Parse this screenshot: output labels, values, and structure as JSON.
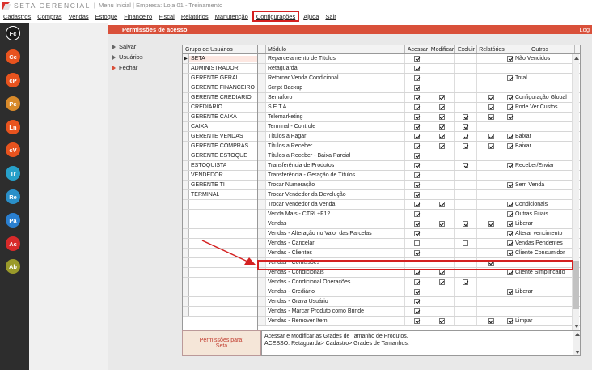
{
  "titlebar": {
    "app_name": "SETA GERENCIAL",
    "sep": "|",
    "info": "Menu Inicial | Empresa: Loja 01 - Treinamento"
  },
  "menu": [
    "Cadastros",
    "Compras",
    "Vendas",
    "Estoque",
    "Financeiro",
    "Fiscal",
    "Relatórios",
    "Manutenção",
    "Configurações",
    "Ajuda",
    "Sair"
  ],
  "sidebar": [
    {
      "label": "Fc",
      "color": "#1a1a1a"
    },
    {
      "label": "Cc",
      "color": "#e8531e"
    },
    {
      "label": "cP",
      "color": "#e8531e"
    },
    {
      "label": "Pc",
      "color": "#d88a2a"
    },
    {
      "label": "Ln",
      "color": "#e8531e"
    },
    {
      "label": "cV",
      "color": "#e8531e"
    },
    {
      "label": "Tr",
      "color": "#27a0c9"
    },
    {
      "label": "Re",
      "color": "#2a8fc9"
    },
    {
      "label": "Pa",
      "color": "#2a7fd0"
    },
    {
      "label": "Ac",
      "color": "#d82a2a"
    },
    {
      "label": "Ab",
      "color": "#9a9a2a"
    }
  ],
  "panel": {
    "title": "Permissões de acesso",
    "log": "Log"
  },
  "actions": [
    "Salvar",
    "Usuários",
    "Fechar"
  ],
  "groups_header": "Grupo de Usuários",
  "groups": [
    "SETA",
    "ADMINISTRADOR",
    "GERENTE GERAL",
    "GERENTE FINANCEIRO",
    "GERENTE CREDIARIO",
    "CREDIARIO",
    "GERENTE CAIXA",
    "CAIXA",
    "GERENTE VENDAS",
    "GERENTE COMPRAS",
    "GERENTE ESTOQUE",
    "ESTOQUISTA",
    "VENDEDOR",
    "GERENTE TI",
    "TERMINAL"
  ],
  "selected_group_index": 0,
  "columns": [
    "Módulo",
    "Acessar",
    "Modificar",
    "Excluir",
    "Relatórios",
    "Outros"
  ],
  "modules": [
    {
      "name": "Reparcelamento de Títulos",
      "ac": true,
      "mo": null,
      "ex": null,
      "re": null,
      "ou": "Não Vencidos",
      "ouc": true
    },
    {
      "name": "Retaguarda",
      "ac": true,
      "mo": null,
      "ex": null,
      "re": null,
      "ou": "",
      "ouc": null
    },
    {
      "name": "Retornar Venda Condicional",
      "ac": true,
      "mo": null,
      "ex": null,
      "re": null,
      "ou": "Total",
      "ouc": true
    },
    {
      "name": "Script Backup",
      "ac": true,
      "mo": null,
      "ex": null,
      "re": null,
      "ou": "",
      "ouc": null
    },
    {
      "name": "Semaforo",
      "ac": true,
      "mo": true,
      "ex": null,
      "re": true,
      "ou": "Configuração Global",
      "ouc": true
    },
    {
      "name": "S.E.T.A.",
      "ac": true,
      "mo": true,
      "ex": null,
      "re": true,
      "ou": "Pode Ver Custos",
      "ouc": true
    },
    {
      "name": "Telemarketing",
      "ac": true,
      "mo": true,
      "ex": true,
      "re": true,
      "ou": "",
      "ouc": true
    },
    {
      "name": "Terminal - Controle",
      "ac": true,
      "mo": true,
      "ex": true,
      "re": null,
      "ou": "",
      "ouc": null
    },
    {
      "name": "Títulos a Pagar",
      "ac": true,
      "mo": true,
      "ex": true,
      "re": true,
      "ou": "Baixar",
      "ouc": true
    },
    {
      "name": "Títulos a Receber",
      "ac": true,
      "mo": true,
      "ex": true,
      "re": true,
      "ou": "Baixar",
      "ouc": true
    },
    {
      "name": "Títulos a Receber - Baixa Parcial",
      "ac": true,
      "mo": null,
      "ex": null,
      "re": null,
      "ou": "",
      "ouc": null
    },
    {
      "name": "Transferência de Produtos",
      "ac": true,
      "mo": null,
      "ex": true,
      "re": null,
      "ou": "Receber/Enviar",
      "ouc": true
    },
    {
      "name": "Transferência - Geração de Títulos",
      "ac": true,
      "mo": null,
      "ex": null,
      "re": null,
      "ou": "",
      "ouc": null
    },
    {
      "name": "Trocar Numeração",
      "ac": true,
      "mo": null,
      "ex": null,
      "re": null,
      "ou": "Sem Venda",
      "ouc": true
    },
    {
      "name": "Trocar Vendedor da Devolução",
      "ac": true,
      "mo": null,
      "ex": null,
      "re": null,
      "ou": "",
      "ouc": null
    },
    {
      "name": "Trocar Vendedor da Venda",
      "ac": true,
      "mo": true,
      "ex": null,
      "re": null,
      "ou": "Condicionais",
      "ouc": true
    },
    {
      "name": "Venda Mais - CTRL+F12",
      "ac": true,
      "mo": null,
      "ex": null,
      "re": null,
      "ou": "Outras Filiais",
      "ouc": true
    },
    {
      "name": "Vendas",
      "ac": true,
      "mo": true,
      "ex": true,
      "re": true,
      "ou": "Liberar",
      "ouc": true
    },
    {
      "name": "Vendas - Alteração no Valor das Parcelas",
      "ac": true,
      "mo": null,
      "ex": null,
      "re": null,
      "ou": "Alterar vencimento",
      "ouc": true
    },
    {
      "name": "Vendas - Cancelar",
      "ac": false,
      "mo": null,
      "ex": false,
      "re": null,
      "ou": "Vendas Pendentes",
      "ouc": true
    },
    {
      "name": "Vendas - Clientes",
      "ac": true,
      "mo": null,
      "ex": null,
      "re": null,
      "ou": "Cliente Consumidor",
      "ouc": true
    },
    {
      "name": "Vendas - Comissões",
      "ac": null,
      "mo": null,
      "ex": null,
      "re": true,
      "ou": "",
      "ouc": null
    },
    {
      "name": "Vendas - Condicionais",
      "ac": true,
      "mo": true,
      "ex": null,
      "re": null,
      "ou": "Cliente Simplificado",
      "ouc": true
    },
    {
      "name": "Vendas - Condicional Operações",
      "ac": true,
      "mo": true,
      "ex": true,
      "re": null,
      "ou": "",
      "ouc": null
    },
    {
      "name": "Vendas - Crediário",
      "ac": true,
      "mo": null,
      "ex": null,
      "re": null,
      "ou": "Liberar",
      "ouc": true
    },
    {
      "name": "Vendas - Grava Usuário",
      "ac": true,
      "mo": null,
      "ex": null,
      "re": null,
      "ou": "",
      "ouc": null
    },
    {
      "name": "Vendas - Marcar Produto como Brinde",
      "ac": true,
      "mo": null,
      "ex": null,
      "re": null,
      "ou": "",
      "ouc": null
    },
    {
      "name": "Vendas - Remover Item",
      "ac": true,
      "mo": true,
      "ex": null,
      "re": true,
      "ou": "Limpar",
      "ouc": true
    }
  ],
  "permissions_for": {
    "label": "Permissões para:",
    "value": "Seta"
  },
  "description": [
    "Acessar e Modificar as Grades de Tamanho de Produtos.",
    "ACESSO: Retaguarda> Cadastro> Grades de Tamanhos."
  ]
}
